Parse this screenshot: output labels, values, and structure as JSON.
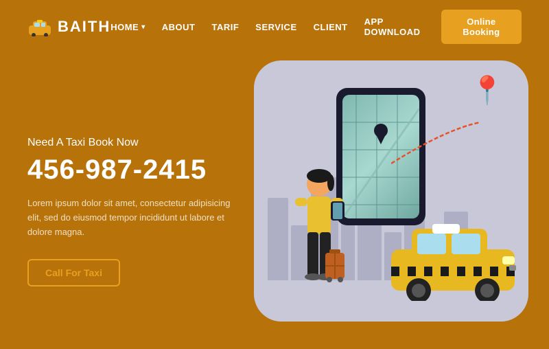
{
  "logo": {
    "text": "BAITH",
    "icon_name": "taxi-logo-icon"
  },
  "nav": {
    "items": [
      {
        "label": "HOME",
        "active": true
      },
      {
        "label": "ABOUT",
        "active": false
      },
      {
        "label": "TARIF",
        "active": false
      },
      {
        "label": "SERVICE",
        "active": false
      },
      {
        "label": "CLIENT",
        "active": false
      },
      {
        "label": "APP DOWNLOAD",
        "active": false
      }
    ],
    "booking_button": "Online Booking"
  },
  "hero": {
    "subtitle": "Need A Taxi Book Now",
    "phone": "456-987-2415",
    "description": "Lorem ipsum dolor sit amet, consectetur adipisicing elit, sed do eiusmod tempor incididunt ut labore et dolore magna.",
    "cta_button": "Call For Taxi"
  },
  "colors": {
    "background": "#B8720A",
    "accent": "#E8A020",
    "illustration_bg": "#c8c8d8"
  }
}
